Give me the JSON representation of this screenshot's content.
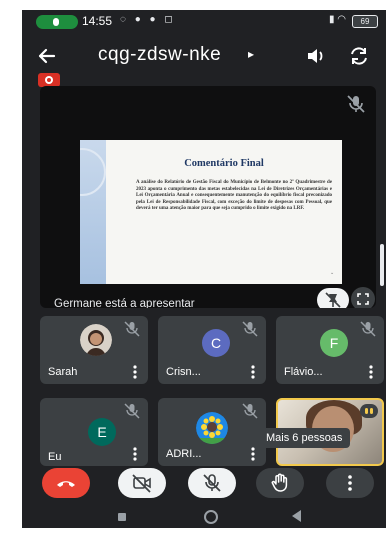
{
  "status_bar": {
    "time": "14:55",
    "battery": "69"
  },
  "header": {
    "meeting_code": "cqg-zdsw-nke",
    "code_chevron": "▸"
  },
  "presentation": {
    "slide_title": "Comentário Final",
    "slide_body": "A análise do Relatório de Gestão Fiscal do Município de Belmonte no 2º Quadrimestre de 2023 aponta o cumprimento das metas estabelecidas na Lei de Diretrizes Orçamentárias e Lei Orçamentária Anual e consequentemente manutenção do equilíbrio fiscal preconizado pela Lei de Responsabilidade Fiscal, com exceção do limite de despesas com Pessoal, que deverá ter uma atenção maior para que seja cumprido o limite exigido na LRF.",
    "presenter_label": "Germane está a apresentar"
  },
  "participants": [
    {
      "name": "Sarah",
      "initial": "",
      "color": ""
    },
    {
      "name": "Crisn...",
      "initial": "C",
      "color": "#5c6bc0"
    },
    {
      "name": "Flávio...",
      "initial": "F",
      "color": "#66bb6a"
    },
    {
      "name": "Eu",
      "initial": "E",
      "color": "#00695c"
    },
    {
      "name": "ADRI...",
      "initial": "",
      "color": ""
    }
  ],
  "more_people_label": "Mais 6 pessoas",
  "colors": {
    "end_call": "#ea4335",
    "tile_bg": "#3c4043",
    "background": "#202124"
  }
}
